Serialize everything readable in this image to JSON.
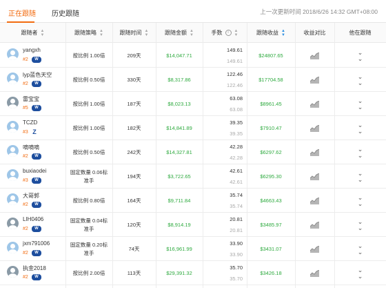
{
  "tabs": {
    "active": "正在跟随",
    "history": "历史跟随"
  },
  "last_update": "上一次更新时间 2018/6/26 14:32 GMT+08:00",
  "columns": {
    "follower": "跟随者",
    "strategy": "跟随策略",
    "time": "跟随时间",
    "amount": "跟随金额",
    "lots": "手数",
    "profit": "跟随收益",
    "compare": "收益对比",
    "followers": "他在跟随"
  },
  "rows": [
    {
      "name": "yangxh",
      "rank": "#2",
      "badge": "W",
      "strategy": "按比例 1.00倍",
      "time": "209天",
      "amount": "$14,047.71",
      "lots": "149.61",
      "lots2": "149.61",
      "profit": "$24807.65"
    },
    {
      "name": "lyp蓝色天空",
      "rank": "#2",
      "badge": "W",
      "strategy": "按比例 0.50倍",
      "time": "330天",
      "amount": "$8,317.86",
      "lots": "122.46",
      "lots2": "122.46",
      "profit": "$17704.58"
    },
    {
      "name": "雷宝宝",
      "rank": "#5",
      "badge": "W",
      "strategy": "按比例 1.00倍",
      "time": "187天",
      "amount": "$8,023.13",
      "lots": "63.08",
      "lots2": "63.08",
      "profit": "$8961.45"
    },
    {
      "name": "TCZD",
      "rank": "#3",
      "badge": "Z",
      "strategy": "按比例 1.00倍",
      "time": "182天",
      "amount": "$14,841.89",
      "lots": "39.35",
      "lots2": "39.35",
      "profit": "$7910.47"
    },
    {
      "name": "嘀嘀嘀",
      "rank": "#2",
      "badge": "W",
      "strategy": "按比例 0.50倍",
      "time": "242天",
      "amount": "$14,327.81",
      "lots": "42.28",
      "lots2": "42.28",
      "profit": "$6297.62"
    },
    {
      "name": "buxiaodei",
      "rank": "#3",
      "badge": "W",
      "strategy": "固定数量 0.06标准手",
      "time": "194天",
      "amount": "$3,722.65",
      "lots": "42.61",
      "lots2": "42.61",
      "profit": "$6295.30"
    },
    {
      "name": "大哥郭",
      "rank": "#2",
      "badge": "W",
      "strategy": "按比例 0.80倍",
      "time": "164天",
      "amount": "$9,711.84",
      "lots": "35.74",
      "lots2": "35.74",
      "profit": "$4663.43"
    },
    {
      "name": "LIH0406",
      "rank": "#2",
      "badge": "W",
      "strategy": "固定数量 0.04标准手",
      "time": "120天",
      "amount": "$8,914.19",
      "lots": "20.81",
      "lots2": "20.81",
      "profit": "$3485.97"
    },
    {
      "name": "jxm791006",
      "rank": "#2",
      "badge": "W",
      "strategy": "固定数量 0.20标准手",
      "time": "74天",
      "amount": "$16,961.99",
      "lots": "33.90",
      "lots2": "33.90",
      "profit": "$3431.07"
    },
    {
      "name": "执金2018",
      "rank": "#2",
      "badge": "W",
      "strategy": "按比例 2.00倍",
      "time": "113天",
      "amount": "$29,391.32",
      "lots": "35.70",
      "lots2": "35.70",
      "profit": "$3426.18"
    }
  ]
}
